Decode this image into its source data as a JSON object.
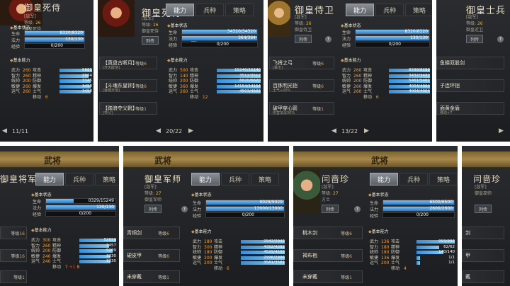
{
  "tabs": {
    "ability": "能力",
    "troop": "兵种",
    "strategy": "策略"
  },
  "header_title": "武将",
  "labels": {
    "basic_state": "基本状态",
    "basic_ability": "基本能力",
    "hp": "生命",
    "mp": "法力",
    "exp": "经验",
    "wu": "武力",
    "zhi": "智力",
    "tong": "统帅",
    "min": "敏捷",
    "yun": "运气",
    "attack": "攻击",
    "spirit": "精神",
    "defense": "防御",
    "burst": "爆发",
    "morale": "士气",
    "move": "移动",
    "level": "等级",
    "rank_label": "[敌军]",
    "lv_label": "等级",
    "list_button": "列传",
    "help": "?"
  },
  "p1": {
    "name": "御皇死侍",
    "lv": "26",
    "rank_title": "御皇死侍",
    "hp": "8320/8320",
    "mp": "130/130",
    "exp": "0/200",
    "stats": [
      "260",
      "260",
      "200",
      "260",
      "260"
    ],
    "derived": [
      "5685",
      "2064",
      "3145",
      "3458",
      "3458"
    ],
    "move": "6",
    "equips": [
      {
        "name": "【真盘古断月】",
        "lv": "6",
        "sub": "[开天辟地]"
      },
      {
        "name": "【斗魂东皇钟】",
        "lv": "6",
        "sub": "[吞噬天地]"
      },
      {
        "name": "【踏浪夺父靴】",
        "lv": "1",
        "sub": "[夺父]"
      }
    ],
    "page": "11/11"
  },
  "p2": {
    "name": "御皇死侍",
    "lv": "26",
    "rank_title": "御皇死侍",
    "hp": "34320/34320",
    "mp": "364/364",
    "exp": "0/200",
    "stats": [
      "500",
      "140",
      "200",
      "360",
      "260"
    ],
    "derived": [
      "15240/15240",
      "3512/3512",
      "6620/6620",
      "14154/14154",
      "4503/4503"
    ],
    "move": "12",
    "page": "20/22"
  },
  "p3": {
    "name": "御皇侍卫",
    "lv": "26",
    "rank_title": "御皇侍卫",
    "hp": "8320/8320",
    "mp": "130/130",
    "exp": "0/200",
    "stats": [
      "260",
      "260",
      "200",
      "260",
      "260"
    ],
    "derived": [
      "8299/8299",
      "3432/3432",
      "5461/5461",
      "4004/4004",
      "4004/4004"
    ],
    "move": "6",
    "equips": [
      {
        "name": "飞将之弓",
        "lv": "6",
        "sub": "[暴击]"
      },
      {
        "name": "百炼明光铠",
        "lv": "6",
        "sub": "士气+20%"
      },
      {
        "name": "破甲穿心箭",
        "lv": "1",
        "sub": "伤害加深30%"
      }
    ],
    "page": "13/22"
  },
  "p4": {
    "name": "御皇士兵",
    "lv": "26",
    "rank_title": "御皇近卫",
    "equips": [
      {
        "name": "鱼鳞双股剑",
        "lv": "",
        "sub": ""
      },
      {
        "name": "子连环铠",
        "lv": "",
        "sub": ""
      },
      {
        "name": "面黄金盾",
        "lv": "",
        "sub": "移动+7"
      }
    ]
  },
  "p5": {
    "name": "御皇将军",
    "hp": "0329/15249",
    "mp": "130/130",
    "exp": "0/200",
    "stats": [
      "300",
      "260",
      "200",
      "240",
      "240"
    ],
    "derived": [
      "52659",
      "2457",
      "5209",
      "3230",
      "3230"
    ],
    "move": "7",
    "move_bonus": "+1",
    "move_total": "8",
    "levels": [
      "16",
      "16",
      "1"
    ]
  },
  "p6": {
    "name": "御皇军师",
    "lv": "27",
    "rank_title": "御皇军师",
    "hp": "9029/9029",
    "mp": "13000/13000",
    "exp": "0/200",
    "stats": [
      "180",
      "300",
      "180",
      "200",
      "200"
    ],
    "derived": [
      "2942/2942",
      "4392/4392",
      "4599/4599",
      "2996/2996",
      "3581/3581"
    ],
    "move": "6",
    "equips": [
      {
        "name": "青铜剑",
        "lv": "6"
      },
      {
        "name": "硬皮甲",
        "lv": "6"
      },
      {
        "name": "未穿戴",
        "lv": "1"
      }
    ]
  },
  "p7": {
    "name": "闫啬珍",
    "lv": "27",
    "rank_title": "方士",
    "hp": "6500/6500",
    "mp": "2600/2600",
    "exp": "0/200",
    "stats": [
      "136",
      "180",
      "180",
      "136",
      "200"
    ],
    "derived": [
      "993/993",
      "62/62",
      "140/140",
      "1/1",
      "1/1"
    ],
    "move": "4",
    "equips": [
      {
        "name": "桃木剑",
        "lv": "6"
      },
      {
        "name": "褐布袍",
        "lv": "6"
      },
      {
        "name": "未穿戴",
        "lv": "1"
      }
    ]
  },
  "p8": {
    "name": "闫啬珍",
    "rank_title": "御皇巫师",
    "equips": [
      {
        "name": "剑"
      },
      {
        "name": "甲"
      },
      {
        "name": "戴"
      }
    ]
  }
}
